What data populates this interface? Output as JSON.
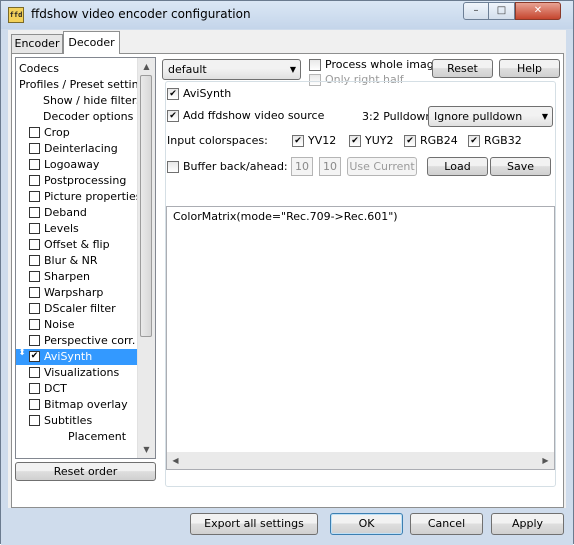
{
  "window": {
    "title": "ffdshow video encoder configuration",
    "icon_text": "ffd",
    "minimize_glyph": "–",
    "maximize_glyph": "□",
    "close_glyph": "✕"
  },
  "tabs": [
    {
      "label": "Encoder"
    },
    {
      "label": "Decoder"
    }
  ],
  "tree": {
    "items": [
      {
        "label": "Codecs",
        "check": ""
      },
      {
        "label": "Profiles / Preset settings",
        "check": ""
      },
      {
        "label": "Show / hide filters",
        "check": ""
      },
      {
        "label": "Decoder options",
        "check": ""
      },
      {
        "label": "Crop",
        "check": ""
      },
      {
        "label": "Deinterlacing",
        "check": ""
      },
      {
        "label": "Logoaway",
        "check": ""
      },
      {
        "label": "Postprocessing",
        "check": ""
      },
      {
        "label": "Picture properties",
        "check": ""
      },
      {
        "label": "Deband",
        "check": ""
      },
      {
        "label": "Levels",
        "check": ""
      },
      {
        "label": "Offset & flip",
        "check": ""
      },
      {
        "label": "Blur & NR",
        "check": ""
      },
      {
        "label": "Sharpen",
        "check": ""
      },
      {
        "label": "Warpsharp",
        "check": ""
      },
      {
        "label": "DScaler filter",
        "check": ""
      },
      {
        "label": "Noise",
        "check": ""
      },
      {
        "label": "Perspective corr.",
        "check": ""
      },
      {
        "label": "AviSynth",
        "check": "✔"
      },
      {
        "label": "Visualizations",
        "check": ""
      },
      {
        "label": "DCT",
        "check": ""
      },
      {
        "label": "Bitmap overlay",
        "check": ""
      },
      {
        "label": "Subtitles",
        "check": ""
      },
      {
        "label": "Placement",
        "check": ""
      }
    ],
    "move_glyph": "⬍",
    "scroll_up": "▲",
    "scroll_down": "▼",
    "reset_order_label": "Reset order"
  },
  "top": {
    "preset_value": "default",
    "process_whole_image": "Process whole image",
    "only_right_half": "Only right half",
    "reset_label": "Reset",
    "help_label": "Help",
    "combo_arrow": "▼"
  },
  "avisynth": {
    "group_label": "AviSynth",
    "group_check": "✔",
    "add_source_label": "Add ffdshow video source",
    "add_source_check": "✔",
    "pulldown_label": "3:2 Pulldown",
    "pulldown_value": "Ignore pulldown",
    "input_colorspaces_label": "Input colorspaces:",
    "colorspaces": [
      {
        "label": "YV12",
        "check": "✔"
      },
      {
        "label": "YUY2",
        "check": "✔"
      },
      {
        "label": "RGB24",
        "check": "✔"
      },
      {
        "label": "RGB32",
        "check": "✔"
      }
    ],
    "buffer_label": "Buffer back/ahead:",
    "buffer_back": "10",
    "buffer_ahead": "10",
    "use_current_label": "Use Current",
    "load_label": "Load",
    "save_label": "Save",
    "script_text": "ColorMatrix(mode=\"Rec.709->Rec.601\")",
    "scroll_left": "◀",
    "scroll_right": "▶"
  },
  "footer": {
    "export_label": "Export all settings",
    "ok_label": "OK",
    "cancel_label": "Cancel",
    "apply_label": "Apply"
  }
}
